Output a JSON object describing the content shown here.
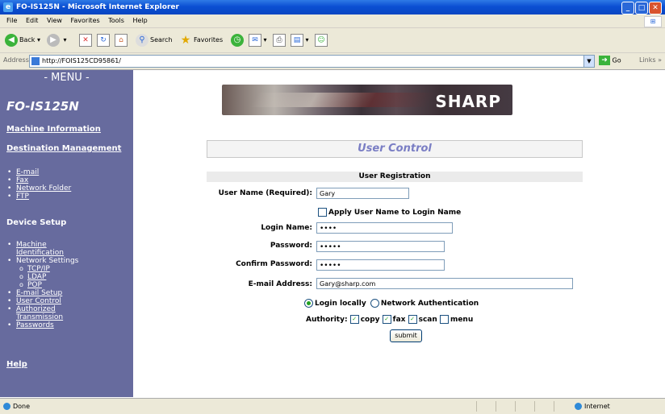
{
  "window": {
    "title": "FO-IS125N - Microsoft Internet Explorer"
  },
  "menubar": {
    "items": [
      "File",
      "Edit",
      "View",
      "Favorites",
      "Tools",
      "Help"
    ]
  },
  "toolbar": {
    "back": "Back",
    "search": "Search",
    "favorites": "Favorites"
  },
  "address": {
    "label": "Address",
    "url": "http://FOIS125CD95861/",
    "go": "Go",
    "links": "Links"
  },
  "sidebar": {
    "menu_header": "- MENU -",
    "model": "FO-IS125N",
    "machine_information": "Machine Information",
    "destination_management": "Destination Management",
    "destination_items": [
      "E-mail",
      "Fax",
      "Network Folder",
      "FTP"
    ],
    "device_setup": "Device Setup",
    "device_items": {
      "machine_identification_1": "Machine",
      "machine_identification_2": "Identification",
      "network_settings": "Network Settings",
      "tcpip": "TCP/IP",
      "ldap": "LDAP",
      "pop": "POP",
      "email_setup": "E-mail Setup",
      "user_control": "User Control",
      "authorized_1": "Authorized",
      "authorized_2": "Transmission",
      "passwords": "Passwords"
    },
    "help": "Help"
  },
  "banner": {
    "brand": "SHARP"
  },
  "form": {
    "title": "User Control",
    "section": "User Registration",
    "user_name_label": "User Name (Required):",
    "user_name_value": "Gary",
    "apply_label": "Apply User Name to Login Name",
    "apply_checked": false,
    "login_name_label": "Login Name:",
    "login_name_value": "••••",
    "password_label": "Password:",
    "password_value": "•••••",
    "confirm_label": "Confirm Password:",
    "confirm_value": "•••••",
    "email_label": "E-mail Address:",
    "email_value": "Gary@sharp.com",
    "login_locally": "Login locally",
    "network_auth": "Network Authentication",
    "login_mode": "Login locally",
    "authority_label": "Authority:",
    "authority": [
      {
        "label": "copy",
        "checked": true
      },
      {
        "label": "fax",
        "checked": true
      },
      {
        "label": "scan",
        "checked": true
      },
      {
        "label": "menu",
        "checked": false
      }
    ],
    "submit": "submit"
  },
  "status": {
    "left": "Done",
    "zone": "Internet"
  },
  "colors": {
    "sidebar": "#676b9e",
    "title_accent": "#7a7ec4",
    "titlebar": "#0b4fd3"
  }
}
